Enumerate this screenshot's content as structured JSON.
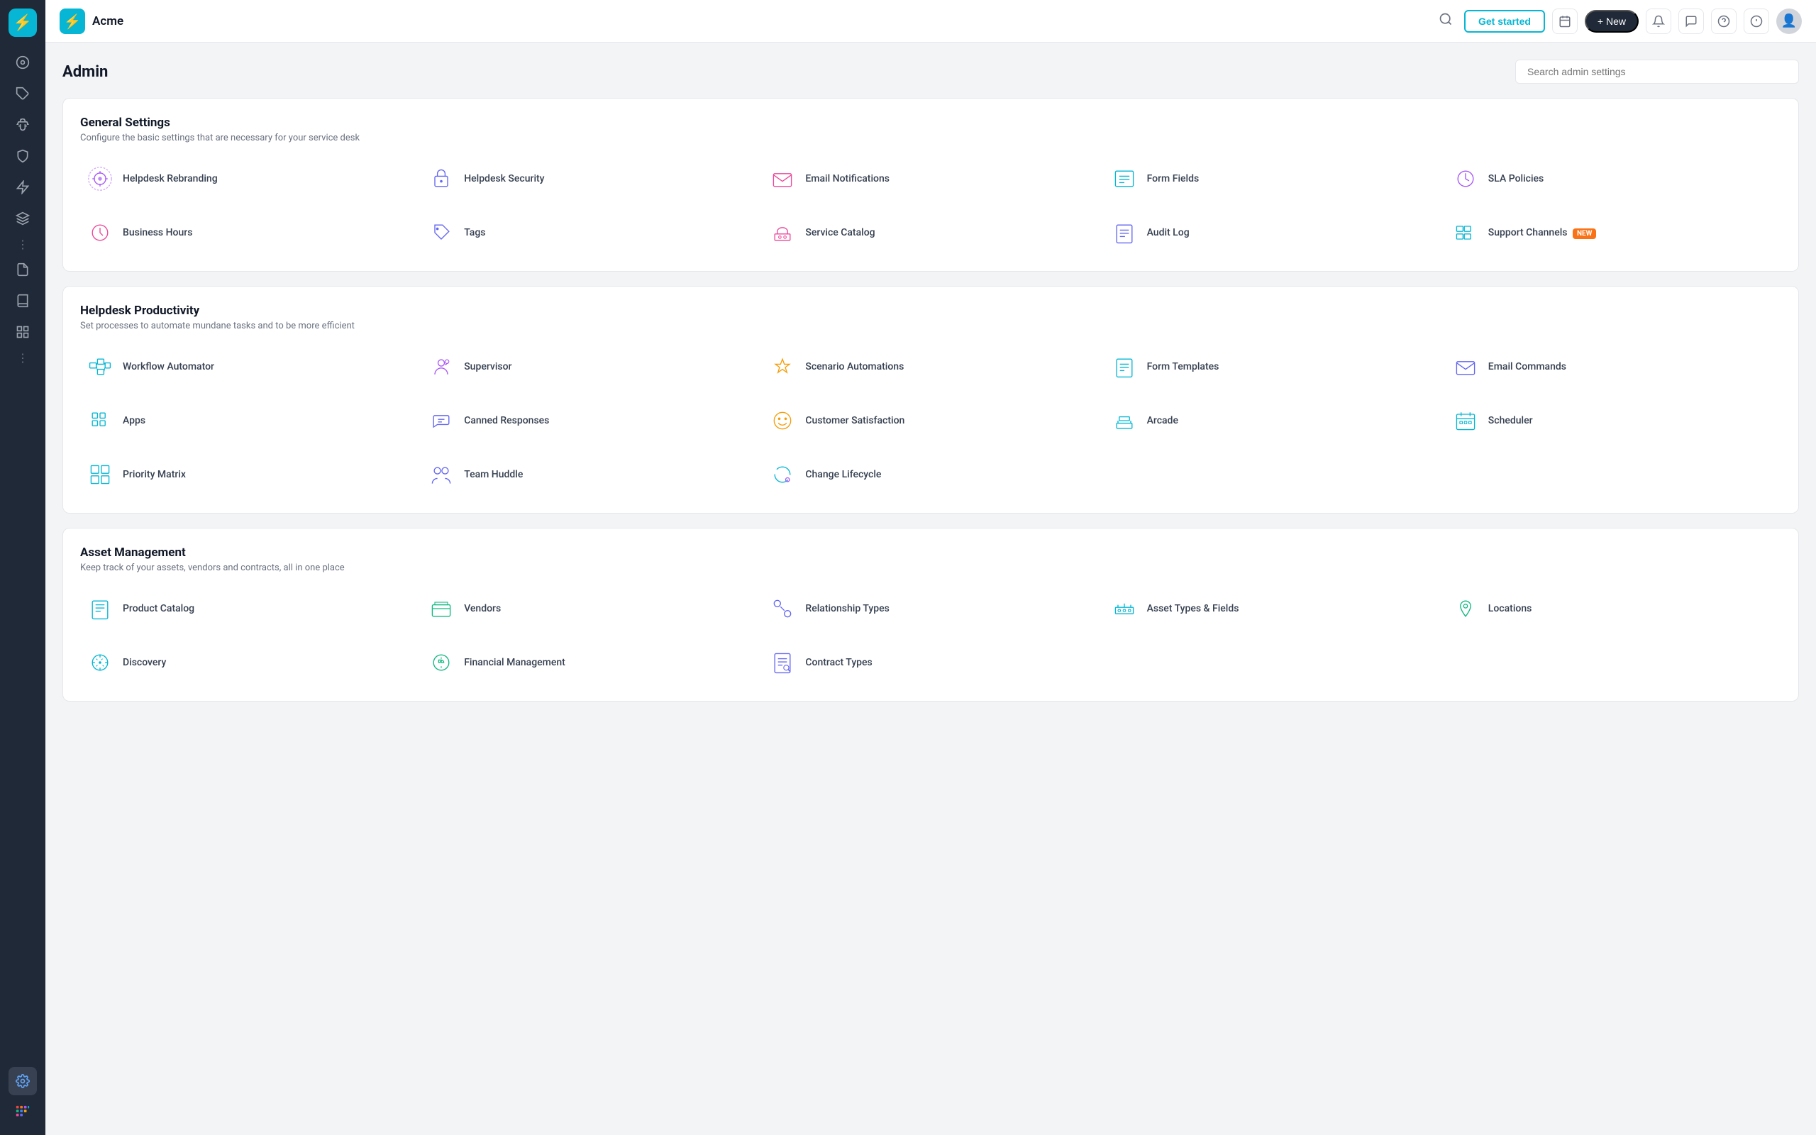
{
  "sidebar": {
    "logo_char": "⚡",
    "brand": "Acme",
    "icons": [
      {
        "name": "home-icon",
        "symbol": "⊙",
        "active": false
      },
      {
        "name": "tag-icon",
        "symbol": "🏷",
        "active": false
      },
      {
        "name": "bug-icon",
        "symbol": "🐛",
        "active": false
      },
      {
        "name": "shield-icon",
        "symbol": "🛡",
        "active": false
      },
      {
        "name": "bolt-icon",
        "symbol": "⚡",
        "active": false
      },
      {
        "name": "layers-icon",
        "symbol": "≡",
        "active": false
      },
      {
        "name": "doc-icon",
        "symbol": "📄",
        "active": false
      },
      {
        "name": "book-icon",
        "symbol": "📖",
        "active": false
      },
      {
        "name": "chart-icon",
        "symbol": "📊",
        "active": false
      }
    ]
  },
  "topbar": {
    "brand": "Acme",
    "get_started_label": "Get started",
    "new_label": "+ New",
    "search_placeholder": "Search admin settings"
  },
  "admin": {
    "title": "Admin",
    "search_placeholder": "Search admin settings"
  },
  "sections": [
    {
      "id": "general",
      "title": "General Settings",
      "subtitle": "Configure the basic settings that are necessary for your service desk",
      "items": [
        {
          "id": "helpdesk-rebranding",
          "label": "Helpdesk Rebranding",
          "icon_color": "#a855f7",
          "icon_type": "rebranding"
        },
        {
          "id": "helpdesk-security",
          "label": "Helpdesk Security",
          "icon_color": "#6366f1",
          "icon_type": "security"
        },
        {
          "id": "email-notifications",
          "label": "Email Notifications",
          "icon_color": "#ec4899",
          "icon_type": "email"
        },
        {
          "id": "form-fields",
          "label": "Form Fields",
          "icon_color": "#06b6d4",
          "icon_type": "form"
        },
        {
          "id": "sla-policies",
          "label": "SLA Policies",
          "icon_color": "#a855f7",
          "icon_type": "sla"
        },
        {
          "id": "business-hours",
          "label": "Business Hours",
          "icon_color": "#ec4899",
          "icon_type": "clock"
        },
        {
          "id": "tags",
          "label": "Tags",
          "icon_color": "#6366f1",
          "icon_type": "tag"
        },
        {
          "id": "service-catalog",
          "label": "Service Catalog",
          "icon_color": "#ec4899",
          "icon_type": "catalog"
        },
        {
          "id": "audit-log",
          "label": "Audit Log",
          "icon_color": "#6366f1",
          "icon_type": "audit"
        },
        {
          "id": "support-channels",
          "label": "Support Channels",
          "icon_color": "#06b6d4",
          "icon_type": "channels",
          "badge": "NEW"
        }
      ]
    },
    {
      "id": "productivity",
      "title": "Helpdesk Productivity",
      "subtitle": "Set processes to automate mundane tasks and to be more efficient",
      "items": [
        {
          "id": "workflow-automator",
          "label": "Workflow Automator",
          "icon_color": "#06b6d4",
          "icon_type": "workflow"
        },
        {
          "id": "supervisor",
          "label": "Supervisor",
          "icon_color": "#a855f7",
          "icon_type": "supervisor"
        },
        {
          "id": "scenario-automations",
          "label": "Scenario Automations",
          "icon_color": "#f59e0b",
          "icon_type": "scenario"
        },
        {
          "id": "form-templates",
          "label": "Form Templates",
          "icon_color": "#06b6d4",
          "icon_type": "formtpl"
        },
        {
          "id": "email-commands",
          "label": "Email Commands",
          "icon_color": "#6366f1",
          "icon_type": "emailcmd"
        },
        {
          "id": "apps",
          "label": "Apps",
          "icon_color": "#06b6d4",
          "icon_type": "apps"
        },
        {
          "id": "canned-responses",
          "label": "Canned Responses",
          "icon_color": "#6366f1",
          "icon_type": "canned"
        },
        {
          "id": "customer-satisfaction",
          "label": "Customer Satisfaction",
          "icon_color": "#f59e0b",
          "icon_type": "csat"
        },
        {
          "id": "arcade",
          "label": "Arcade",
          "icon_color": "#06b6d4",
          "icon_type": "arcade"
        },
        {
          "id": "scheduler",
          "label": "Scheduler",
          "icon_color": "#06b6d4",
          "icon_type": "scheduler"
        },
        {
          "id": "priority-matrix",
          "label": "Priority Matrix",
          "icon_color": "#06b6d4",
          "icon_type": "matrix"
        },
        {
          "id": "team-huddle",
          "label": "Team Huddle",
          "icon_color": "#6366f1",
          "icon_type": "huddle"
        },
        {
          "id": "change-lifecycle",
          "label": "Change Lifecycle",
          "icon_color": "#06b6d4",
          "icon_type": "lifecycle"
        }
      ]
    },
    {
      "id": "asset",
      "title": "Asset Management",
      "subtitle": "Keep track of your assets, vendors and contracts, all in one place",
      "items": [
        {
          "id": "product-catalog",
          "label": "Product Catalog",
          "icon_color": "#06b6d4",
          "icon_type": "productcat"
        },
        {
          "id": "vendors",
          "label": "Vendors",
          "icon_color": "#10b981",
          "icon_type": "vendors"
        },
        {
          "id": "relationship-types",
          "label": "Relationship Types",
          "icon_color": "#6366f1",
          "icon_type": "relationship"
        },
        {
          "id": "asset-types-fields",
          "label": "Asset Types & Fields",
          "icon_color": "#06b6d4",
          "icon_type": "assettypes"
        },
        {
          "id": "locations",
          "label": "Locations",
          "icon_color": "#10b981",
          "icon_type": "locations"
        },
        {
          "id": "discovery",
          "label": "Discovery",
          "icon_color": "#06b6d4",
          "icon_type": "discovery"
        },
        {
          "id": "financial-management",
          "label": "Financial Management",
          "icon_color": "#10b981",
          "icon_type": "financial"
        },
        {
          "id": "contract-types",
          "label": "Contract Types",
          "icon_color": "#6366f1",
          "icon_type": "contract"
        }
      ]
    }
  ]
}
